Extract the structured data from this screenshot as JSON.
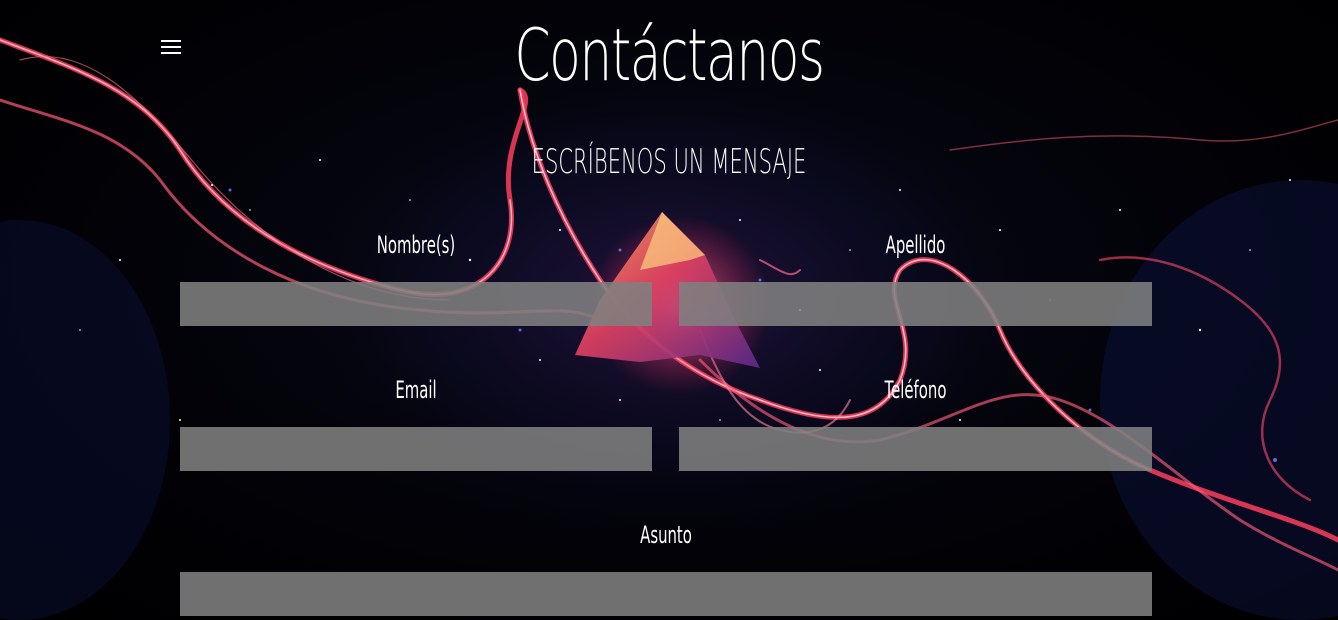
{
  "header": {
    "menu_icon": "hamburger-menu-icon",
    "title": "Contáctanos"
  },
  "form": {
    "heading": "ESCRÍBENOS UN MENSAJE",
    "fields": {
      "first_name": {
        "label": "Nombre(s)",
        "value": ""
      },
      "last_name": {
        "label": "Apellido",
        "value": ""
      },
      "email": {
        "label": "Email",
        "value": ""
      },
      "phone": {
        "label": "Teléfono",
        "value": ""
      },
      "subject": {
        "label": "Asunto",
        "value": ""
      }
    }
  },
  "colors": {
    "background": "#000000",
    "text": "#ffffff",
    "input_fill": "#808080",
    "accent_glow": "#ff3d5e"
  }
}
